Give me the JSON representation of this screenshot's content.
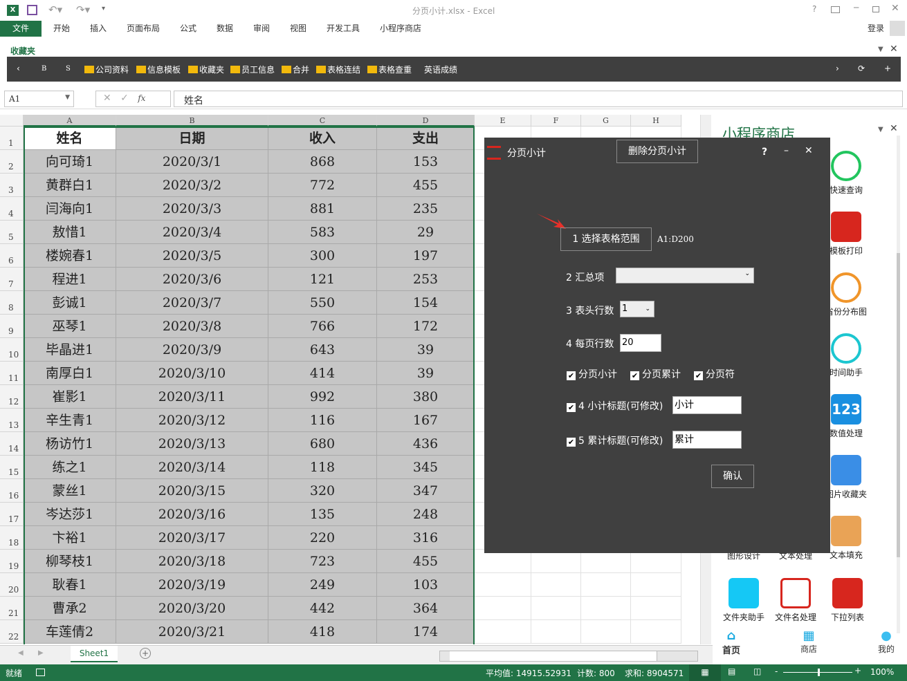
{
  "window": {
    "title": "分页小计.xlsx - Excel",
    "login": "登录",
    "help": "?"
  },
  "ribbon": {
    "file": "文件",
    "tabs": [
      "开始",
      "插入",
      "页面布局",
      "公式",
      "数据",
      "审阅",
      "视图",
      "开发工具",
      "小程序商店"
    ]
  },
  "favorites": {
    "label": "收藏夹",
    "b": "B",
    "s": "S",
    "folders": [
      "公司资料",
      "信息模板",
      "收藏夹",
      "员工信息",
      "合并",
      "表格连结",
      "表格查重"
    ],
    "extra": "英语成绩"
  },
  "formula_bar": {
    "name_box": "A1",
    "fx": "fx",
    "value": "姓名"
  },
  "columns": [
    "A",
    "B",
    "C",
    "D",
    "E",
    "F",
    "G",
    "H"
  ],
  "table": {
    "header": [
      "姓名",
      "日期",
      "收入",
      "支出"
    ],
    "rows": [
      [
        "向可琦1",
        "2020/3/1",
        "868",
        "153"
      ],
      [
        "黄群白1",
        "2020/3/2",
        "772",
        "455"
      ],
      [
        "闫海向1",
        "2020/3/3",
        "881",
        "235"
      ],
      [
        "敖惜1",
        "2020/3/4",
        "583",
        "29"
      ],
      [
        "楼婉春1",
        "2020/3/5",
        "300",
        "197"
      ],
      [
        "程进1",
        "2020/3/6",
        "121",
        "253"
      ],
      [
        "彭诚1",
        "2020/3/7",
        "550",
        "154"
      ],
      [
        "巫琴1",
        "2020/3/8",
        "766",
        "172"
      ],
      [
        "毕晶进1",
        "2020/3/9",
        "643",
        "39"
      ],
      [
        "南厚白1",
        "2020/3/10",
        "414",
        "39"
      ],
      [
        "崔影1",
        "2020/3/11",
        "992",
        "380"
      ],
      [
        "辛生青1",
        "2020/3/12",
        "116",
        "167"
      ],
      [
        "杨访竹1",
        "2020/3/13",
        "680",
        "436"
      ],
      [
        "练之1",
        "2020/3/14",
        "118",
        "345"
      ],
      [
        "蒙丝1",
        "2020/3/15",
        "320",
        "347"
      ],
      [
        "岑达莎1",
        "2020/3/16",
        "135",
        "248"
      ],
      [
        "卞裕1",
        "2020/3/17",
        "220",
        "316"
      ],
      [
        "柳琴枝1",
        "2020/3/18",
        "723",
        "455"
      ],
      [
        "耿春1",
        "2020/3/19",
        "249",
        "103"
      ],
      [
        "曹承2",
        "2020/3/20",
        "442",
        "364"
      ],
      [
        "车莲倩2",
        "2020/3/21",
        "418",
        "174"
      ]
    ]
  },
  "panel": {
    "title": "小程序商店",
    "items": [
      {
        "label": "快速查询",
        "color": "#22c55e"
      },
      {
        "label": "模板打印",
        "color": "#d7261e"
      },
      {
        "label": "省份分布图",
        "color": "#f0952a"
      },
      {
        "label": "时间助手",
        "color": "#1cc6d0"
      },
      {
        "label": "数值处理",
        "color": "#1a8fe0",
        "text": "123"
      },
      {
        "label": "图片收藏夹",
        "color": "#3a8ee6"
      },
      {
        "label": "文本填充",
        "color": "#e9a356"
      }
    ],
    "row_hidden": [
      "图形设计",
      "文本处理"
    ],
    "bottom_row": [
      {
        "label": "文件夹助手",
        "color": "#15c8f5"
      },
      {
        "label": "文件名处理",
        "color": "#d7261e"
      },
      {
        "label": "下拉列表",
        "color": "#d7261e"
      }
    ],
    "nav": [
      "首页",
      "商店",
      "我的"
    ]
  },
  "dialog": {
    "title": "分页小计",
    "delete_btn": "删除分页小计",
    "help": "?",
    "step1_btn": "1 选择表格范围",
    "range": "A1:D200",
    "step2": "2 汇总项",
    "step2_value": "",
    "step3": "3 表头行数",
    "step3_value": "1",
    "step4": "4 每页行数",
    "step4_value": "20",
    "checks": [
      {
        "label": "分页小计",
        "checked": true
      },
      {
        "label": "分页累计",
        "checked": true
      },
      {
        "label": "分页符",
        "checked": true
      }
    ],
    "sub_title_label": "4 小计标题(可修改)",
    "sub_title_value": "小计",
    "cum_title_label": "5 累计标题(可修改)",
    "cum_title_value": "累计",
    "confirm": "确认",
    "accent": "#d7261e"
  },
  "sheet": {
    "tab": "Sheet1"
  },
  "status": {
    "ready": "就绪",
    "avg": "平均值: 14915.52931",
    "count": "计数: 800",
    "sum": "求和: 8904571",
    "zoom": "100%",
    "zoom_level": 100
  }
}
